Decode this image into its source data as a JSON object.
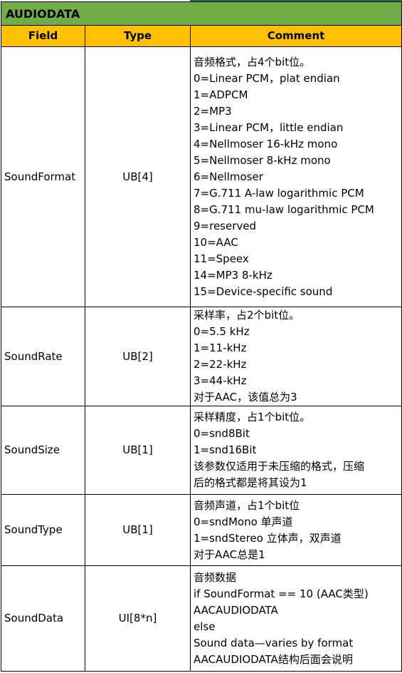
{
  "title": "AUDIODATA",
  "columns": [
    "Field",
    "Type",
    "Comment"
  ],
  "rows": [
    {
      "field": "SoundFormat",
      "type": "UB[4]",
      "comment": [
        "音频格式，占4个bit位。",
        "0=Linear PCM，plat endian",
        "1=ADPCM",
        "2=MP3",
        "3=Linear PCM，little endian",
        "4=Nellmoser 16-kHz mono",
        "5=Nellmoser 8-kHz mono",
        "6=Nellmoser",
        "7=G.711 A-law logarithmic PCM",
        "8=G.711 mu-law logarithmic PCM",
        "9=reserved",
        "10=AAC",
        "11=Speex",
        "14=MP3 8-kHz",
        "15=Device-specific sound"
      ]
    },
    {
      "field": "SoundRate",
      "type": "UB[2]",
      "comment": [
        "采样率，占2个bit位。",
        "0=5.5 kHz",
        "1=11-kHz",
        "2=22-kHz",
        "3=44-kHz",
        "对于AAC，该值总为3"
      ]
    },
    {
      "field": "SoundSize",
      "type": "UB[1]",
      "comment": [
        "采样精度，占1个bit位。",
        "0=snd8Bit",
        "1=snd16Bit",
        "该参数仅适用于未压缩的格式，压缩",
        "后的格式都是将其设为1"
      ]
    },
    {
      "field": "SoundType",
      "type": "UB[1]",
      "comment": [
        "音频声道，占1个bit位",
        "0=sndMono 单声道",
        "1=sndStereo 立体声，双声道",
        "对于AAC总是1"
      ]
    },
    {
      "field": "SoundData",
      "type": "UI[8*n]",
      "comment": [
        "音频数据",
        "if SoundFormat == 10 (AAC类型)",
        "AACAUDIODATA",
        "else",
        "Sound data—varies by format",
        "AACAUDIODATA结构后面会说明"
      ]
    }
  ]
}
